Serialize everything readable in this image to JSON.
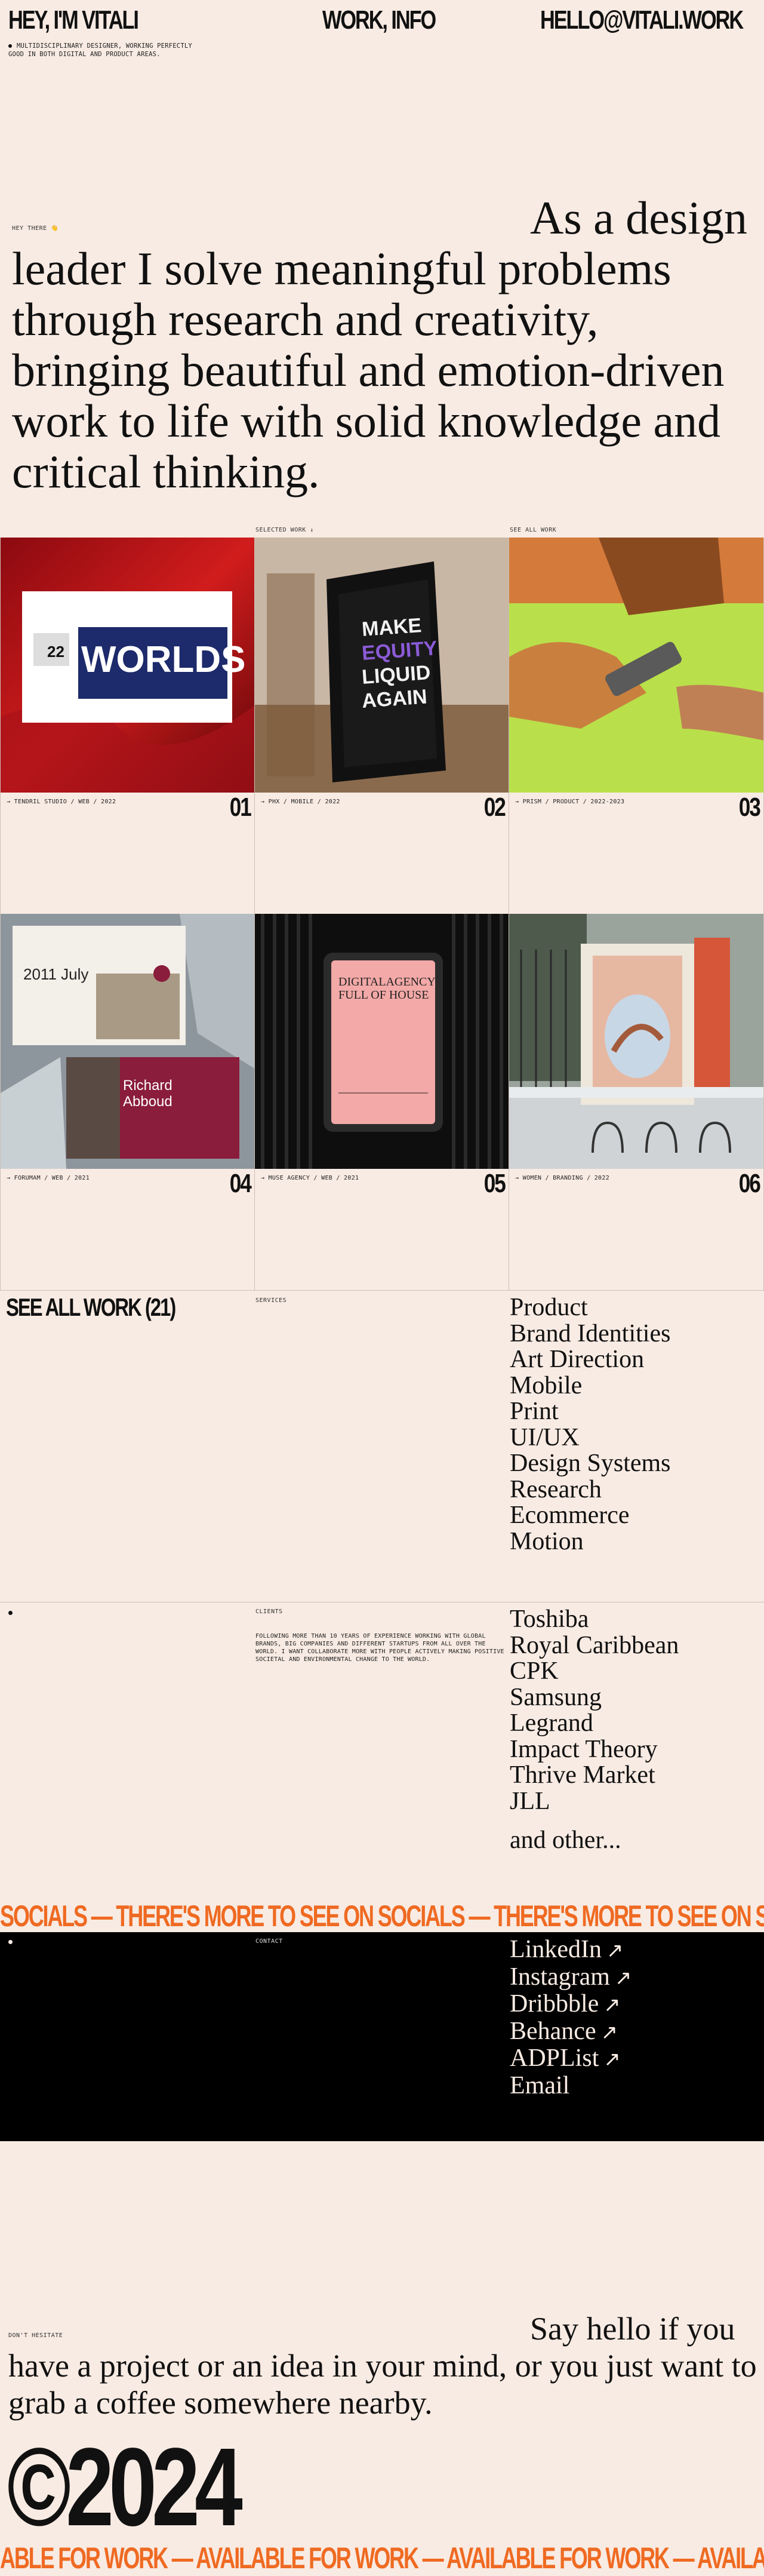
{
  "header": {
    "name": "HEY, I'M VITALI",
    "nav": "WORK, INFO",
    "email": "HELLO@VITALI.WORK",
    "tagline": "MULTIDISCIPLINARY DESIGNER, WORKING PERFECTLY GOOD IN BOTH DIGITAL AND PRODUCT AREAS."
  },
  "intro": {
    "label": "HEY THERE 👋",
    "text": "As a design leader I solve meaningful problems through research and creativity, bringing beautiful and emotion-driven work to life with solid knowledge and critical thinking."
  },
  "work": {
    "selected_label": "SELECTED WORK ↓",
    "see_all_label": "SEE ALL WORK",
    "cards": [
      {
        "meta": "→ TENDRIL STUDIO / WEB / 2022",
        "num": "01",
        "poster_text": "WORLDS"
      },
      {
        "meta": "→ PHX / MOBILE / 2022",
        "num": "02",
        "poster_text": "MAKE EQUITY LIQUID AGAIN"
      },
      {
        "meta": "→ PRISM / PRODUCT / 2022-2023",
        "num": "03"
      },
      {
        "meta": "→ FORUMAM / WEB / 2021",
        "num": "04",
        "date_text": "2011 July",
        "person": "Richard Abboud"
      },
      {
        "meta": "→ MUSE AGENCY / WEB / 2021",
        "num": "05",
        "poster_text": "DIGITALAGENCY FULL OF HOUSE"
      },
      {
        "meta": "→ WOMEN / BRANDING / 2022",
        "num": "06"
      }
    ],
    "see_all_big": "SEE ALL WORK (21)"
  },
  "services": {
    "label": "SERVICES",
    "items": [
      "Product",
      "Brand Identities",
      "Art Direction",
      "Mobile",
      "Print",
      "UI/UX",
      "Design Systems",
      "Research",
      "Ecommerce",
      "Motion"
    ]
  },
  "clients": {
    "label": "CLIENTS",
    "description": "FOLLOWING MORE THAN 10 YEARS OF EXPERIENCE WORKING WITH GLOBAL BRANDS, BIG COMPANIES AND DIFFERENT STARTUPS FROM ALL OVER THE WORLD. I WANT COLLABORATE MORE WITH PEOPLE ACTIVELY MAKING POSITIVE SOCIETAL AND ENVIRONMENTAL CHANGE TO THE WORLD.",
    "items": [
      "Toshiba",
      "Royal Caribbean",
      "CPK",
      "Samsung",
      "Legrand",
      "Impact Theory",
      "Thrive Market",
      "JLL"
    ],
    "other": "and other..."
  },
  "marquee_socials": "SOCIALS — THERE'S MORE TO SEE ON SOCIALS — THERE'S MORE TO SEE ON SOCIALS —",
  "contact": {
    "label": "CONTACT",
    "links": [
      {
        "label": "LinkedIn",
        "arrow": "↗"
      },
      {
        "label": "Instagram",
        "arrow": "↗"
      },
      {
        "label": "Dribbble",
        "arrow": "↗"
      },
      {
        "label": "Behance",
        "arrow": "↗"
      },
      {
        "label": "ADPList",
        "arrow": "↗"
      }
    ],
    "email": "Email"
  },
  "footer": {
    "label": "DON'T HESITATE",
    "text": "Say hello if you have a project or an idea in your mind, or you just want to grab a coffee somewhere nearby.",
    "copyright": "©2024",
    "marquee": "ABLE FOR WORK — AVAILABLE FOR WORK — AVAILABLE FOR WORK — AVAILABLE FOR WORK — AVAILABLE FOR WORK —"
  },
  "colors": {
    "background": "#f8ebe3",
    "accent": "#ef6a22",
    "ink": "#111111"
  }
}
